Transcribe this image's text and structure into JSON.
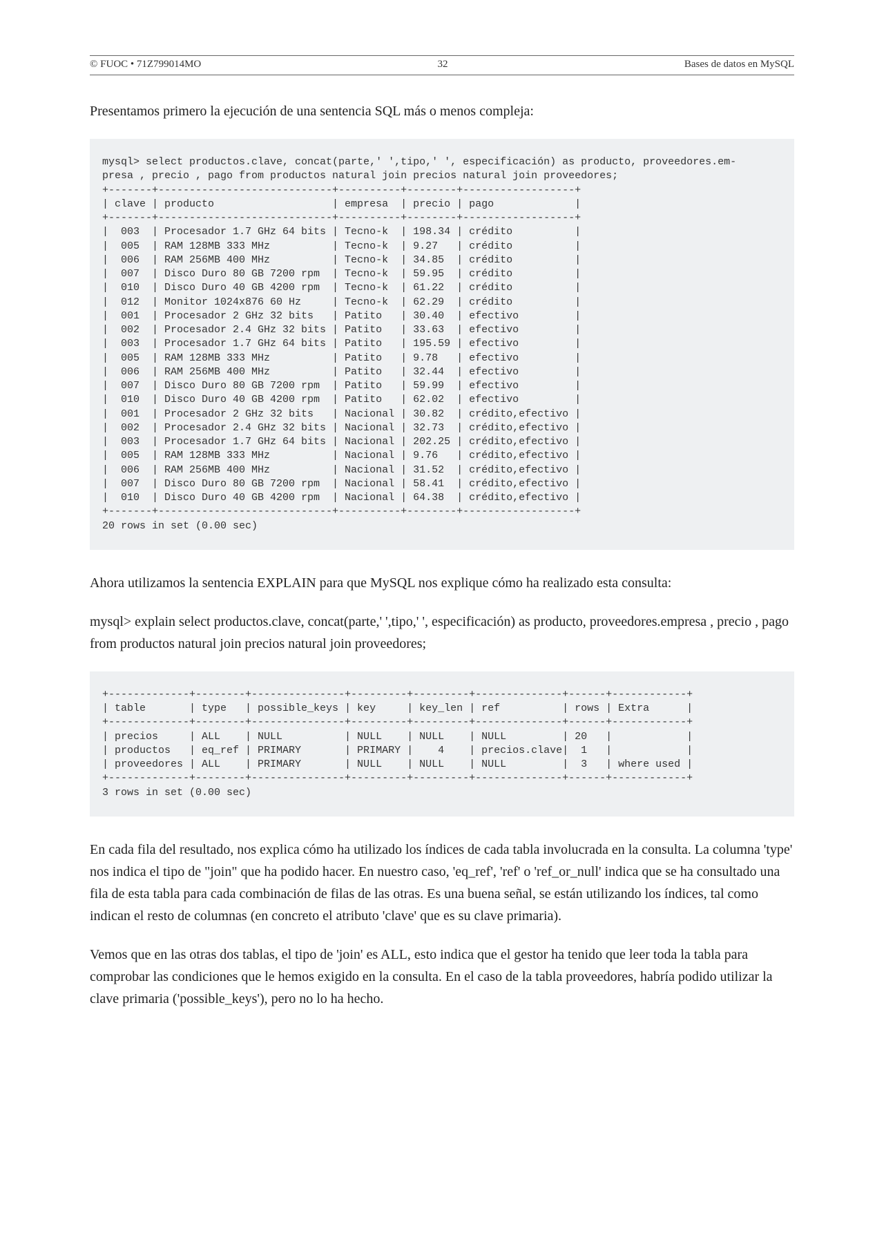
{
  "header": {
    "left": "© FUOC • 71Z799014MO",
    "center": "32",
    "right": "Bases de datos en MySQL"
  },
  "para1": "Presentamos primero la ejecución de una sentencia SQL más o menos compleja:",
  "code1": {
    "prompt_line1": "mysql> select productos.clave, concat(parte,' ',tipo,' ', especificación) as producto, proveedores.em-",
    "prompt_line2": "presa , precio , pago from productos natural join precios natural join proveedores;",
    "rule": "+-------+----------------------------+----------+--------+------------------+",
    "headers": "| clave | producto                   | empresa  | precio | pago             |",
    "rows": [
      "|  003  | Procesador 1.7 GHz 64 bits | Tecno-k  | 198.34 | crédito          |",
      "|  005  | RAM 128MB 333 MHz          | Tecno-k  | 9.27   | crédito          |",
      "|  006  | RAM 256MB 400 MHz          | Tecno-k  | 34.85  | crédito          |",
      "|  007  | Disco Duro 80 GB 7200 rpm  | Tecno-k  | 59.95  | crédito          |",
      "|  010  | Disco Duro 40 GB 4200 rpm  | Tecno-k  | 61.22  | crédito          |",
      "|  012  | Monitor 1024x876 60 Hz     | Tecno-k  | 62.29  | crédito          |",
      "|  001  | Procesador 2 GHz 32 bits   | Patito   | 30.40  | efectivo         |",
      "|  002  | Procesador 2.4 GHz 32 bits | Patito   | 33.63  | efectivo         |",
      "|  003  | Procesador 1.7 GHz 64 bits | Patito   | 195.59 | efectivo         |",
      "|  005  | RAM 128MB 333 MHz          | Patito   | 9.78   | efectivo         |",
      "|  006  | RAM 256MB 400 MHz          | Patito   | 32.44  | efectivo         |",
      "|  007  | Disco Duro 80 GB 7200 rpm  | Patito   | 59.99  | efectivo         |",
      "|  010  | Disco Duro 40 GB 4200 rpm  | Patito   | 62.02  | efectivo         |",
      "|  001  | Procesador 2 GHz 32 bits   | Nacional | 30.82  | crédito,efectivo |",
      "|  002  | Procesador 2.4 GHz 32 bits | Nacional | 32.73  | crédito,efectivo |",
      "|  003  | Procesador 1.7 GHz 64 bits | Nacional | 202.25 | crédito,efectivo |",
      "|  005  | RAM 128MB 333 MHz          | Nacional | 9.76   | crédito,efectivo |",
      "|  006  | RAM 256MB 400 MHz          | Nacional | 31.52  | crédito,efectivo |",
      "|  007  | Disco Duro 80 GB 7200 rpm  | Nacional | 58.41  | crédito,efectivo |",
      "|  010  | Disco Duro 40 GB 4200 rpm  | Nacional | 64.38  | crédito,efectivo |"
    ],
    "footer": "20 rows in set (0.00 sec)"
  },
  "para2": "Ahora utilizamos la sentencia EXPLAIN para que MySQL nos explique cómo ha realizado esta consulta:",
  "para3": "mysql> explain select productos.clave, concat(parte,' ',tipo,' ', especificación) as producto, proveedores.empresa , precio , pago from productos natural join precios natural join proveedores;",
  "code2": {
    "rule": "+-------------+--------+---------------+---------+---------+--------------+------+------------+",
    "headers": "| table       | type   | possible_keys | key     | key_len | ref          | rows | Extra      |",
    "rows": [
      "| precios     | ALL    | NULL          | NULL    | NULL    | NULL         | 20   |            |",
      "| productos   | eq_ref | PRIMARY       | PRIMARY |    4    | precios.clave|  1   |            |",
      "| proveedores | ALL    | PRIMARY       | NULL    | NULL    | NULL         |  3   | where used |"
    ],
    "footer": "3 rows in set (0.00 sec)"
  },
  "para4": "En cada fila del resultado, nos explica cómo ha utilizado los índices de cada tabla involucrada en la consulta. La columna 'type' nos indica el tipo de \"join\" que ha podido hacer. En nuestro caso, 'eq_ref', 'ref' o 'ref_or_null' indica que se ha consultado una fila de esta tabla para cada combinación de filas de las otras. Es una buena señal, se están utilizando los índices, tal como indican el resto de columnas (en concreto el atributo 'clave' que es su clave primaria).",
  "para5": "Vemos que en las otras dos tablas, el tipo de 'join' es ALL, esto indica que el gestor ha tenido que leer toda la tabla para comprobar las condiciones que le hemos exigido en la consulta. En el caso de la tabla proveedores, habría podido utilizar la clave primaria ('possible_keys'), pero no lo ha hecho."
}
